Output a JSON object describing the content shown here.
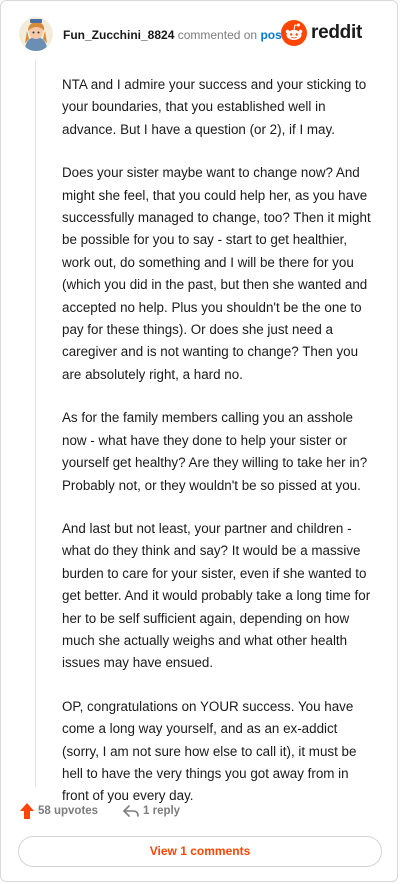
{
  "comment": {
    "username": "Fun_Zucchini_8824",
    "commented_on": "commented on",
    "post_link": "post"
  },
  "brand": {
    "name": "reddit",
    "color": "#ff4500"
  },
  "paragraphs": [
    "NTA and I admire your success and your sticking to your boundaries, that you established well in advance. But I have a question (or 2), if I may.",
    "Does your sister maybe want to change now? And might she feel, that you could help her, as you have successfully managed to change, too? Then it might be possible for you to say - start to get healthier, work out, do something and I will be there for you (which you did in the past, but then she wanted and accepted no help. Plus you shouldn't be the one to pay for these things). Or does she just need a caregiver and is not wanting to change? Then you are absolutely right, a hard no.",
    "As for the family members calling you an asshole now - what have they done to help your sister or yourself get healthy? Are they willing to take her in? Probably not, or they wouldn't be so pissed at you.",
    "And last but not least, your partner and children - what do they think and say? It would be a massive burden to care for your sister, even if she wanted to get better. And it would probably take a long time for her to be self sufficient again, depending on how much she actually weighs and what other health issues may have ensued.",
    "OP, congratulations on YOUR success. You have come a long way yourself, and as an ex-addict (sorry, I am not sure how else to call it), it must be hell to have the very things you got away from in front of you every day."
  ],
  "actions": {
    "upvotes": "58 upvotes",
    "replies": "1 reply",
    "upvote_icon": "upvote-arrow-icon",
    "reply_icon": "reply-arrow-icon"
  },
  "view_comments_label": "View 1 comments",
  "colors": {
    "accent": "#ff4500",
    "link": "#0079d3",
    "muted": "#7c7c7c"
  }
}
